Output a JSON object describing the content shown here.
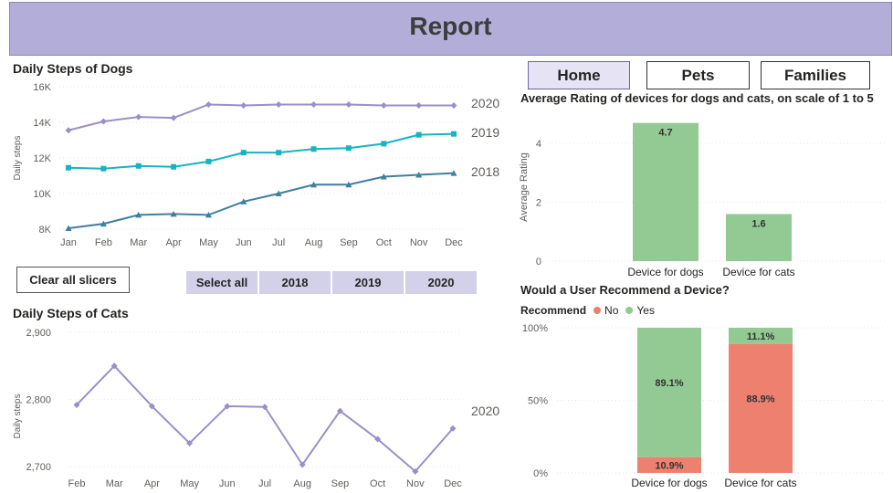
{
  "header": {
    "title": "Report"
  },
  "nav": {
    "home": "Home",
    "pets": "Pets",
    "families": "Families"
  },
  "colors": {
    "header_bg": "#b3aed9",
    "series_2020": "#9b8fc7",
    "series_2019": "#18b3c3",
    "series_2018": "#3f7fa0",
    "yes": "#93c993",
    "no": "#ee8070"
  },
  "dogs_chart": {
    "title": "Daily Steps of Dogs",
    "ylabel": "Daily steps",
    "chart_data": {
      "type": "line",
      "categories": [
        "Jan",
        "Feb",
        "Mar",
        "Apr",
        "May",
        "Jun",
        "Jul",
        "Aug",
        "Sep",
        "Oct",
        "Nov",
        "Dec"
      ],
      "y_ticks": [
        "8K",
        "10K",
        "12K",
        "14K",
        "16K"
      ],
      "ylim": [
        8000,
        16000
      ],
      "series": [
        {
          "name": "2020",
          "values": [
            13550,
            14050,
            14300,
            14250,
            15000,
            14950,
            15000,
            15000,
            15000,
            14950,
            14950,
            14950
          ]
        },
        {
          "name": "2019",
          "values": [
            11450,
            11400,
            11550,
            11500,
            11800,
            12300,
            12300,
            12500,
            12550,
            12800,
            13300,
            13350
          ]
        },
        {
          "name": "2018",
          "values": [
            8050,
            8300,
            8800,
            8850,
            8800,
            9550,
            10000,
            10500,
            10500,
            10950,
            11050,
            11150
          ]
        }
      ]
    }
  },
  "clear_button": "Clear all slicers",
  "slicer": {
    "items": [
      "Select all",
      "2018",
      "2019",
      "2020"
    ]
  },
  "cats_chart": {
    "title": "Daily Steps of Cats",
    "ylabel": "Daily steps",
    "chart_data": {
      "type": "line",
      "categories": [
        "Feb",
        "Mar",
        "Apr",
        "May",
        "Jun",
        "Jul",
        "Aug",
        "Sep",
        "Oct",
        "Nov",
        "Dec"
      ],
      "y_ticks": [
        "2,700",
        "2,800",
        "2,900"
      ],
      "ylim": [
        2650,
        2900
      ],
      "series": [
        {
          "name": "2020",
          "values": [
            2792,
            2850,
            2790,
            2735,
            2790,
            2789,
            2703,
            2783,
            2741,
            2693,
            2757
          ]
        }
      ]
    }
  },
  "rating_chart": {
    "title": "Average Rating of devices for dogs and cats, on scale of 1 to 5",
    "ylabel": "Average Rating",
    "chart_data": {
      "type": "bar",
      "categories": [
        "Device for dogs",
        "Device for cats"
      ],
      "values": [
        4.7,
        1.6
      ],
      "value_labels": [
        "4.7",
        "1.6"
      ],
      "y_ticks": [
        "0",
        "2",
        "4"
      ],
      "ylim": [
        0,
        5
      ]
    }
  },
  "recommend_chart": {
    "title": "Would a User Recommend a Device?",
    "legend": {
      "label": "Recommend",
      "no": "No",
      "yes": "Yes"
    },
    "chart_data": {
      "type": "bar",
      "stacked": "100%",
      "categories": [
        "Device for dogs",
        "Device for cats"
      ],
      "y_ticks": [
        "0%",
        "50%",
        "100%"
      ],
      "series": [
        {
          "name": "No",
          "values": [
            10.9,
            88.9
          ],
          "labels": [
            "10.9%",
            "88.9%"
          ]
        },
        {
          "name": "Yes",
          "values": [
            89.1,
            11.1
          ],
          "labels": [
            "89.1%",
            "11.1%"
          ]
        }
      ]
    }
  }
}
